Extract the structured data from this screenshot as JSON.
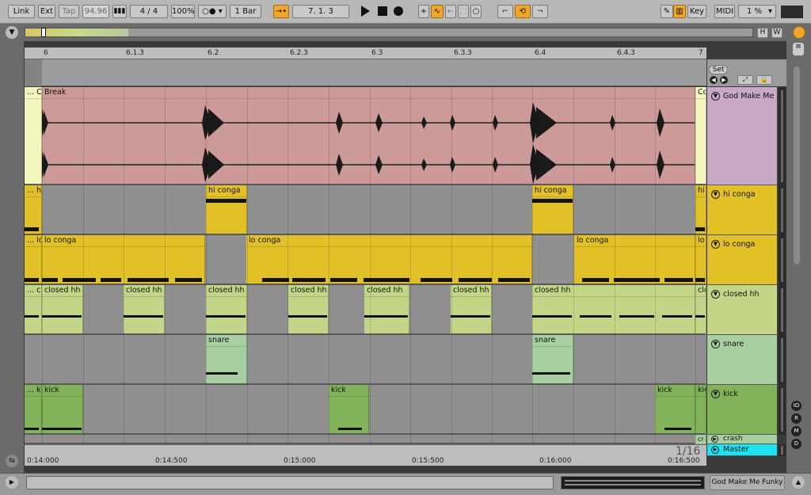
{
  "toolbar": {
    "link": "Link",
    "ext": "Ext",
    "tap": "Tap",
    "tempo": "94.96",
    "signature": "4 / 4",
    "zoom": "100%",
    "quantize": "1 Bar",
    "position": "7.  1.  3",
    "key": "Key",
    "midi": "MIDI",
    "cpu": "1 %"
  },
  "overview": {
    "h": "H",
    "w": "W"
  },
  "ruler": {
    "bars": [
      "6",
      "6.1.3",
      "6.2",
      "6.2.3",
      "6.3",
      "6.3.3",
      "6.4",
      "6.4.3",
      "7"
    ],
    "times": [
      "0:14:000",
      "0:14:500",
      "0:15:000",
      "0:15:500",
      "0:16:000",
      "0:16:500"
    ]
  },
  "set": {
    "label": "Set"
  },
  "tracks": [
    {
      "name": "God Make Me",
      "color": "#c9a8c8"
    },
    {
      "name": "hi conga",
      "color": "#e2c028"
    },
    {
      "name": "lo conga",
      "color": "#e2c028"
    },
    {
      "name": "closed hh",
      "color": "#c3d687"
    },
    {
      "name": "snare",
      "color": "#a8cfa0"
    },
    {
      "name": "kick",
      "color": "#82b35a"
    },
    {
      "name": "crash",
      "color": "#a8cfa0"
    }
  ],
  "master": {
    "name": "Master",
    "color": "#1ee3f0"
  },
  "clips": {
    "break_left": "... C",
    "break": "Break",
    "break_right": "Co",
    "hi_left": "... hi",
    "hi_conga": "hi conga",
    "hi_right": "hi",
    "lo_left": "... lo",
    "lo_conga": "lo conga",
    "lo_right": "lo",
    "hh_left": "... cl",
    "closed_hh": "closed hh",
    "hh_right": "clo",
    "snare": "snare",
    "kick_left": "... ki",
    "kick": "kick",
    "kick_right": "kic",
    "crash_right": "cr"
  },
  "grid_label": "1/16",
  "status": {
    "clip_name": "God Make Me Funky"
  },
  "colors": {
    "accent": "#f0a62d",
    "break": "#cc9a99",
    "conga": "#e2c028",
    "hh": "#c3d687",
    "snare": "#a8cfa0",
    "kick": "#82b35a",
    "master": "#1ee3f0"
  }
}
